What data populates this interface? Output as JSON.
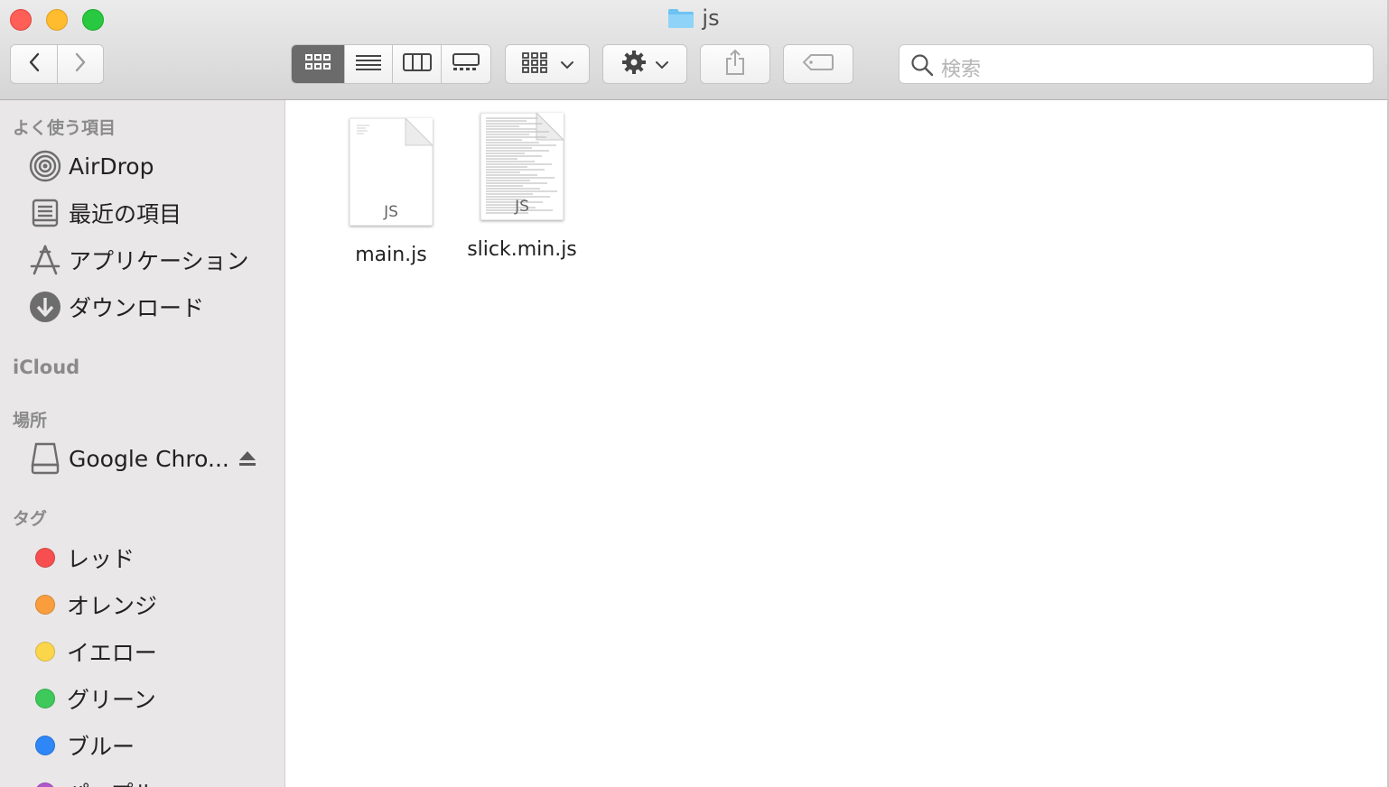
{
  "window": {
    "title": "js"
  },
  "toolbar": {
    "back_icon": "chevron-left-icon",
    "forward_icon": "chevron-right-icon",
    "view_modes": [
      "icon-view",
      "list-view",
      "column-view",
      "gallery-view"
    ],
    "active_view": "icon-view",
    "search_placeholder": "検索"
  },
  "sidebar": {
    "favorites_heading": "よく使う項目",
    "favorites": [
      {
        "label": "AirDrop",
        "icon": "airdrop-icon"
      },
      {
        "label": "最近の項目",
        "icon": "recents-icon"
      },
      {
        "label": "アプリケーション",
        "icon": "applications-icon"
      },
      {
        "label": "ダウンロード",
        "icon": "downloads-icon"
      }
    ],
    "icloud_heading": "iCloud",
    "locations_heading": "場所",
    "locations": [
      {
        "label": "Google Chro...",
        "icon": "disk-icon"
      }
    ],
    "tags_heading": "タグ",
    "tags": [
      {
        "label": "レッド",
        "color": "#f74f4f"
      },
      {
        "label": "オレンジ",
        "color": "#f99d3d"
      },
      {
        "label": "イエロー",
        "color": "#fbd64a"
      },
      {
        "label": "グリーン",
        "color": "#3ec95a"
      },
      {
        "label": "ブルー",
        "color": "#2f86f6"
      },
      {
        "label": "パープル",
        "color": "#b057cc"
      }
    ]
  },
  "files": [
    {
      "name": "main.js",
      "badge": "JS"
    },
    {
      "name": "slick.min.js",
      "badge": "JS"
    }
  ]
}
